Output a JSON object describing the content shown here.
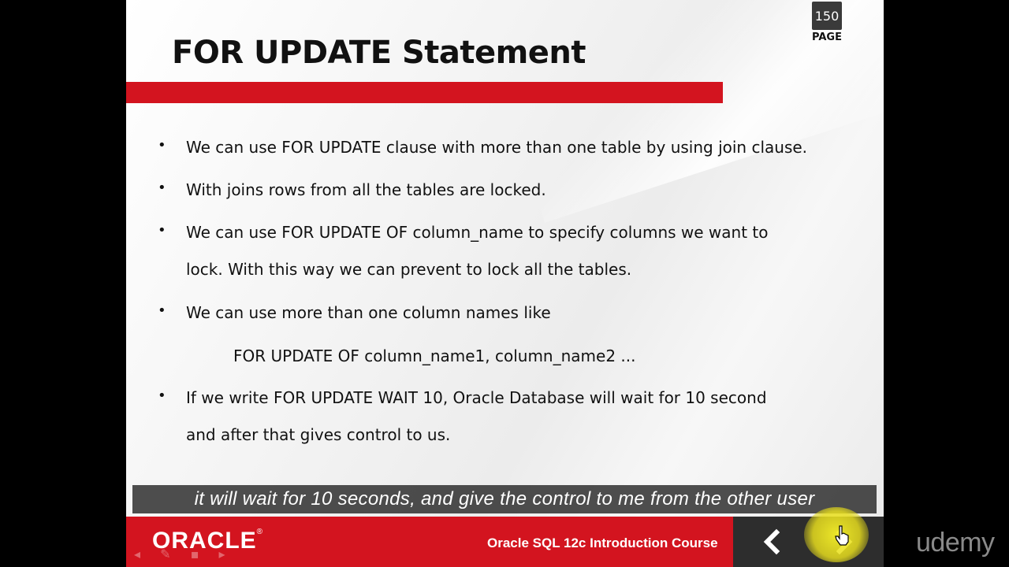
{
  "slide": {
    "title": "FOR UPDATE Statement",
    "page_number": "150",
    "page_label": "PAGE",
    "bullets": [
      {
        "lines": [
          "We can use FOR UPDATE clause with more than one table by using join clause."
        ]
      },
      {
        "lines": [
          "With joins rows from all the tables are locked."
        ]
      },
      {
        "lines": [
          "We can use FOR UPDATE OF column_name to specify columns we want to",
          "lock. With this way we can prevent to lock all the tables."
        ]
      },
      {
        "lines": [
          "We can use more than one column names like"
        ]
      },
      {
        "lines": [
          "If we write FOR UPDATE WAIT 10, Oracle Database will wait for 10 second",
          "and after that gives control to us."
        ]
      }
    ],
    "code_example": "FOR UPDATE OF column_name1, column_name2 ...",
    "bullet_glyph": "•"
  },
  "caption": "it will wait for 10 seconds, and give the control to me from the other user",
  "footer": {
    "brand": "ORACLE",
    "course_title": "Oracle SQL 12c Introduction Course",
    "prev_icon": "‹",
    "next_icon": "›",
    "accent_color": "#d3141f"
  },
  "watermark": "udemy"
}
